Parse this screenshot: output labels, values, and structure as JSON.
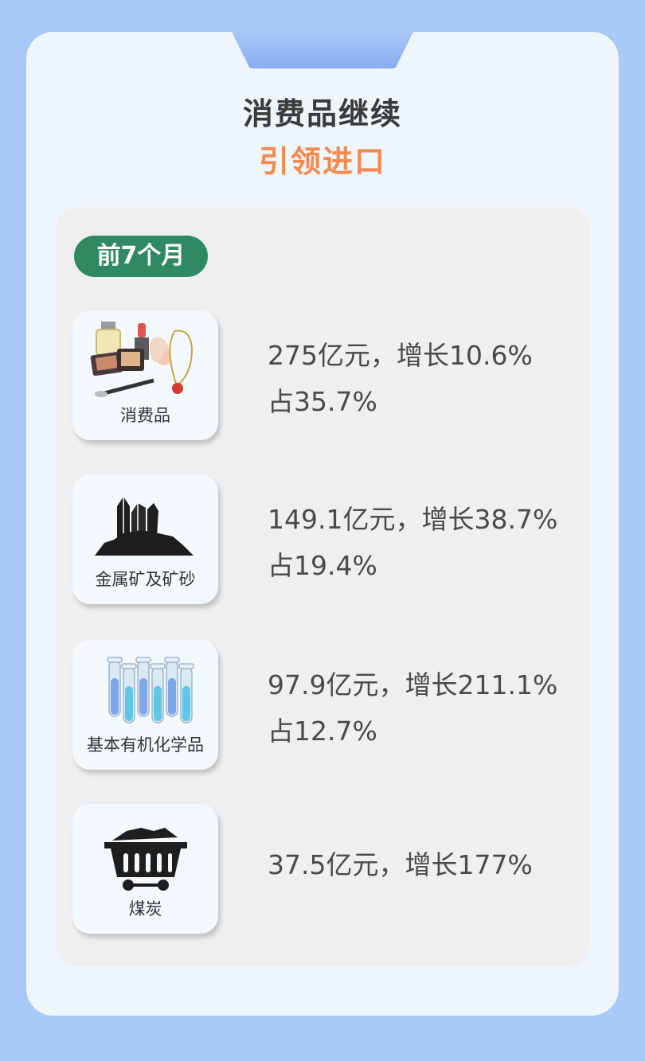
{
  "header": {
    "title_line1": "消费品继续",
    "title_line2": "引领进口"
  },
  "badge": {
    "label": "前7个月"
  },
  "items": [
    {
      "icon": "cosmetics-icon",
      "label": "消费品",
      "value": "275亿元，增长10.6%",
      "share": "占35.7%"
    },
    {
      "icon": "ore-icon",
      "label": "金属矿及矿砂",
      "value": "149.1亿元，增长38.7%",
      "share": "占19.4%"
    },
    {
      "icon": "test-tubes-icon",
      "label": "基本有机化学品",
      "value": "97.9亿元，增长211.1%",
      "share": "占12.7%"
    },
    {
      "icon": "coal-cart-icon",
      "label": "煤炭",
      "value": "37.5亿元，增长177%",
      "share": ""
    }
  ],
  "colors": {
    "background": "#a9caf6",
    "card": "#eef6fc",
    "title_dark": "#3a3a3a",
    "title_accent": "#f48a4e",
    "badge": "#2f8a63"
  }
}
